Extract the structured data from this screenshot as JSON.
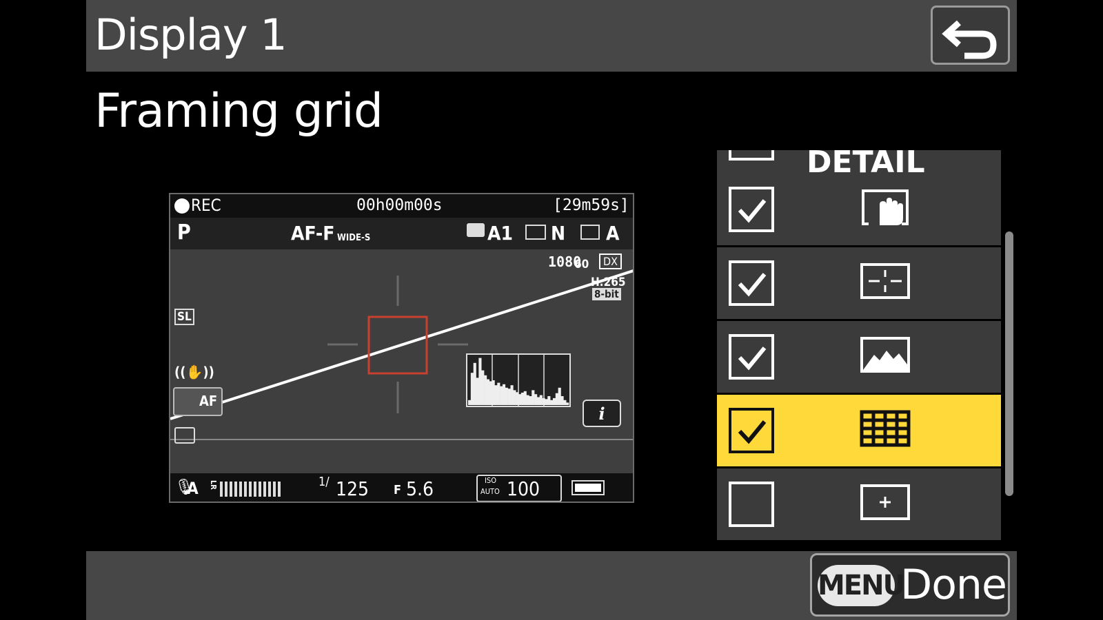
{
  "header": {
    "title": "Display 1",
    "back_icon": "return-arrow-icon"
  },
  "subtitle": "Framing grid",
  "preview": {
    "rec": "REC",
    "timecode": "00h00m00s",
    "remaining": "[29m59s]",
    "mode": "P",
    "af_mode": "AF-F",
    "af_area": "WIDE-S",
    "wb": "A1",
    "picture_control": "N",
    "active_d": "A",
    "frame_size": "1080",
    "frame_rate": "60",
    "crop": "DX",
    "codec": "H.265",
    "bit_depth": "8-bit",
    "silent_label": "SL",
    "touch_af": "AF",
    "mic": "A",
    "level_lr": "LR",
    "shutter_prefix": "1/",
    "shutter": "125",
    "aperture_prefix": "F",
    "aperture": "5.6",
    "iso_top": "ISO",
    "iso_bottom": "AUTO",
    "iso": "100",
    "info_button": "i",
    "histogram_levels": [
      0.1,
      0.65,
      0.85,
      0.55,
      0.95,
      0.7,
      0.6,
      0.52,
      0.48,
      0.5,
      0.4,
      0.45,
      0.38,
      0.42,
      0.35,
      0.33,
      0.4,
      0.3,
      0.26,
      0.22,
      0.25,
      0.28,
      0.2,
      0.18,
      0.3,
      0.22,
      0.16,
      0.2,
      0.14,
      0.12,
      0.18,
      0.1,
      0.14,
      0.24,
      0.35,
      0.18,
      0.1,
      0.05
    ]
  },
  "list": {
    "partial_item_text": "DETAIL",
    "items": [
      {
        "checked": true,
        "icon": "touch-controls-icon",
        "selected": false
      },
      {
        "checked": true,
        "icon": "focus-point-icon",
        "selected": false
      },
      {
        "checked": true,
        "icon": "histogram-icon",
        "selected": false
      },
      {
        "checked": true,
        "icon": "framing-grid-icon",
        "selected": true
      },
      {
        "checked": false,
        "icon": "center-mark-icon",
        "selected": false
      }
    ]
  },
  "footer": {
    "menu_label": "MENU",
    "done_label": "Done"
  },
  "colors": {
    "highlight": "#ffd83a",
    "bar": "#474747",
    "focus_frame": "#c8412e"
  }
}
